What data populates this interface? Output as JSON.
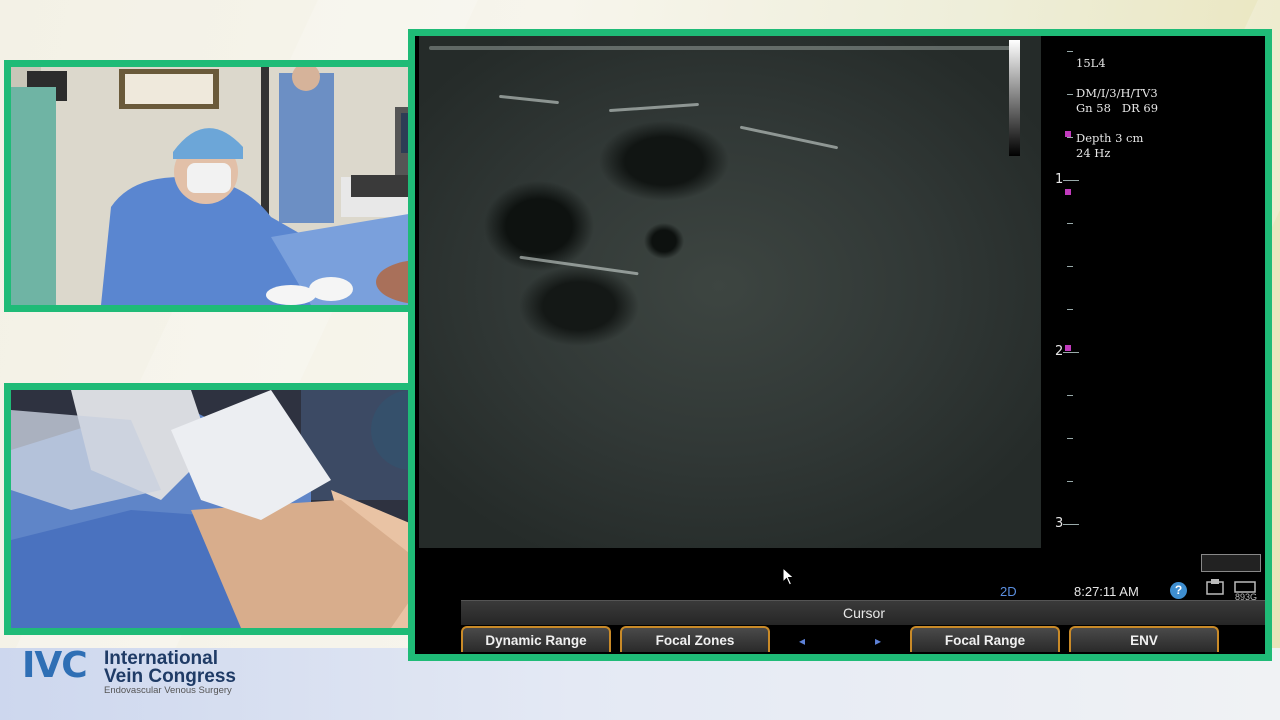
{
  "branding": {
    "logo_mark": "IVC",
    "name_line1": "International",
    "name_line2": "Vein Congress",
    "subtitle": "Endovascular Venous Surgery",
    "accent_color": "#1fbb77"
  },
  "ultrasound": {
    "probe": "15L4",
    "preset": "DM/I/3/H/TV3",
    "gain_dr": "Gn 58   DR 69",
    "depth": "Depth 3 cm",
    "frame_rate": "24 Hz",
    "depth_marks": [
      "1",
      "2",
      "3"
    ],
    "mode": "2D",
    "time": "8:27:11 AM",
    "help_glyph": "?",
    "corner_code": "893G",
    "cursor_label": "Cursor",
    "softkeys": {
      "dynamic_range": "Dynamic Range",
      "focal_zones": "Focal Zones",
      "focal_range": "Focal Range",
      "env": "ENV"
    },
    "arrow_left": "◂",
    "arrow_right": "▸"
  },
  "icons": {
    "help": "help-icon",
    "mouse_pointer": "mouse-pointer-icon"
  }
}
